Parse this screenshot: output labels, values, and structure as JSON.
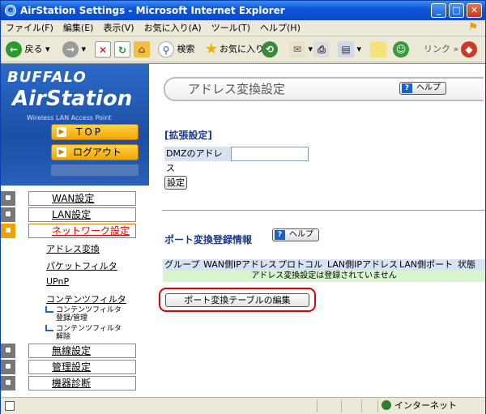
{
  "window": {
    "title": "AirStation Settings - Microsoft Internet Explorer"
  },
  "menubar": {
    "items": [
      "ファイル(F)",
      "編集(E)",
      "表示(V)",
      "お気に入り(A)",
      "ツール(T)",
      "ヘルプ(H)"
    ]
  },
  "toolbar": {
    "back_label": "戻る",
    "search_label": "検索",
    "favorites_label": "お気に入り",
    "links_label": "リンク"
  },
  "brand": {
    "line1": "BUFFALO",
    "line2": "AirStation",
    "line3": "Wireless LAN Access Point"
  },
  "nav": {
    "top_label": "TOP",
    "logout_label": "ログアウト"
  },
  "sidebar": {
    "items": [
      {
        "label": "WAN設定"
      },
      {
        "label": "LAN設定"
      },
      {
        "label": "ネットワーク設定"
      },
      {
        "label": "無線設定"
      },
      {
        "label": "管理設定"
      },
      {
        "label": "機器診断"
      }
    ],
    "subitems": [
      "アドレス変換",
      "パケットフィルタ",
      "UPnP",
      "コンテンツフィルタ"
    ],
    "subsub": [
      "コンテンツフィルタ 登録/管理",
      "コンテンツフィルタ 解除"
    ]
  },
  "main": {
    "page_title": "アドレス変換設定",
    "help_label": "ヘルプ",
    "section_extended": "[拡張設定]",
    "dmz_label": "DMZのアドレス",
    "dmz_value": "",
    "set_button": "設定",
    "section_port": "ポート変換登録情報",
    "table_headers": [
      "グループ",
      "WAN側IPアドレス",
      "プロトコル",
      "LAN側IPアドレス",
      "LAN側ポート",
      "状態"
    ],
    "table_empty": "アドレス変換設定は登録されていません",
    "edit_button": "ポート変換テーブルの編集"
  },
  "status": {
    "zone": "インターネット"
  }
}
